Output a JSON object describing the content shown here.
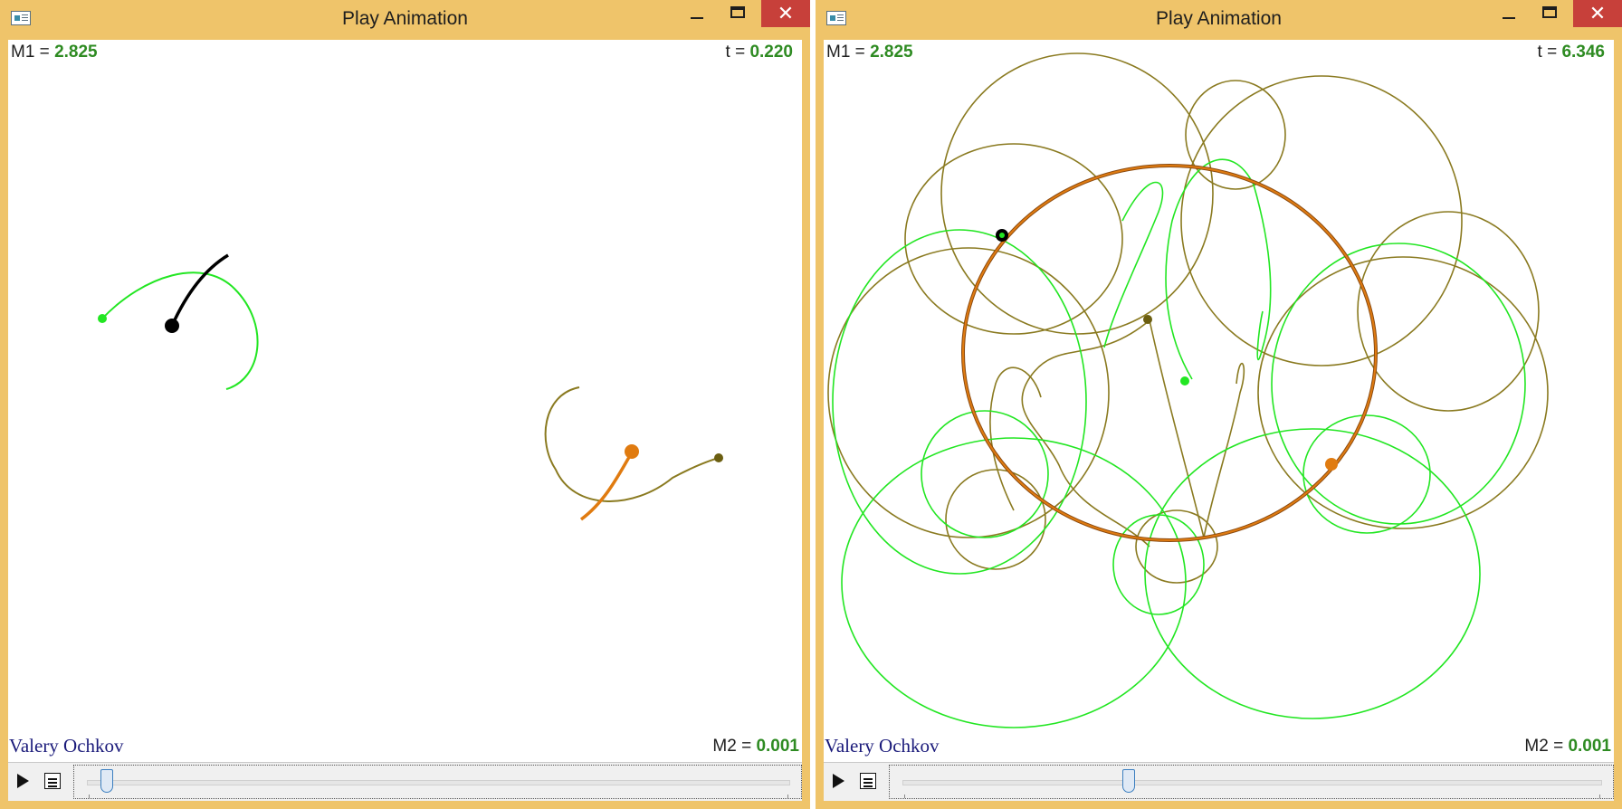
{
  "windows": [
    {
      "title": "Play Animation",
      "close_glyph": "✕",
      "m1_label": "M1 = ",
      "m1_value": "2.825",
      "t_label": "t = ",
      "t_value": "0.220",
      "m2_label": "M2 = ",
      "m2_value": "0.001",
      "author": "Valery Ochkov",
      "icons": [
        "app-icon",
        "minimize-icon",
        "maximize-icon",
        "close-icon",
        "play-icon",
        "list-icon"
      ],
      "slider_position": 0.02
    },
    {
      "title": "Play Animation",
      "close_glyph": "✕",
      "m1_label": "M1 = ",
      "m1_value": "2.825",
      "t_label": "t = ",
      "t_value": "6.346",
      "m2_label": "M2 = ",
      "m2_value": "0.001",
      "author": "Valery Ochkov",
      "icons": [
        "app-icon",
        "minimize-icon",
        "maximize-icon",
        "close-icon",
        "play-icon",
        "list-icon"
      ],
      "slider_position": 0.32
    }
  ],
  "colors": {
    "frame": "#efc46a",
    "close_button": "#c7403a",
    "value_text": "#2e8b22",
    "author_text": "#1a1a7a",
    "body_m1": "#000000",
    "body_m2": "#e07b10",
    "trace_green": "#22e622",
    "trace_olive": "#8a7a20"
  }
}
